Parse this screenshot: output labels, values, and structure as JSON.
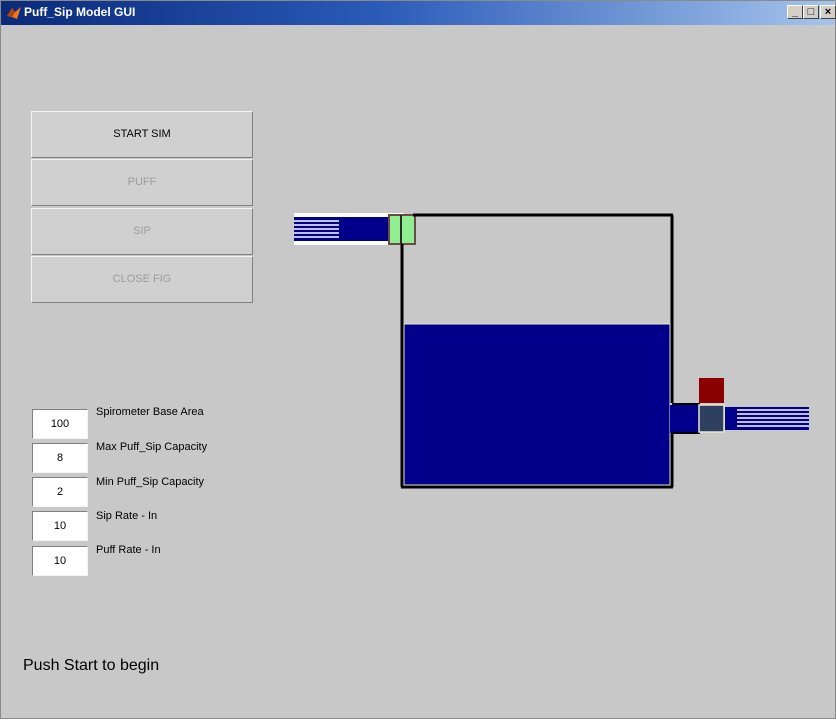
{
  "window": {
    "title": "Puff_Sip Model GUI",
    "icon": "matlab-icon",
    "controls": {
      "minimize": "_",
      "maximize": "□",
      "close": "×"
    }
  },
  "buttons": {
    "start": "START SIM",
    "puff": "PUFF",
    "sip": "SIP",
    "close_fig": "CLOSE FIG"
  },
  "parameters": [
    {
      "value": "100",
      "label": "Spirometer Base Area"
    },
    {
      "value": "8",
      "label": "Max Puff_Sip Capacity"
    },
    {
      "value": "2",
      "label": "Min Puff_Sip Capacity"
    },
    {
      "value": "10",
      "label": "Sip Rate - In"
    },
    {
      "value": "10",
      "label": "Puff Rate - In"
    }
  ],
  "status": "Push Start to begin",
  "colors": {
    "background": "#c8c8c8",
    "fluid": "#00008b",
    "valve_open": "#90ee90",
    "valve_closed": "#8b0000",
    "valve_dark": "#2f3f5f"
  }
}
